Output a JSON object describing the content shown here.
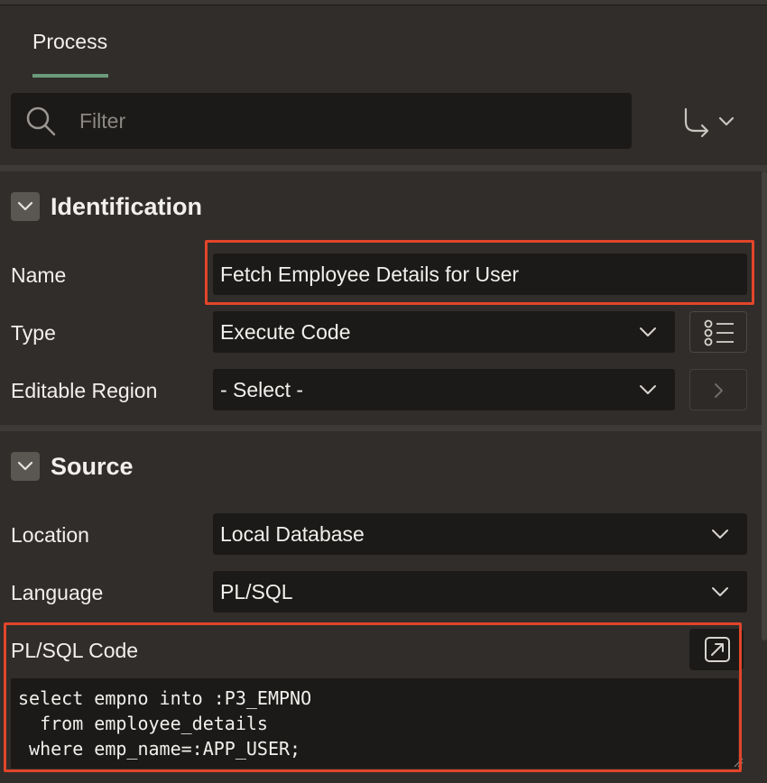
{
  "tabs": [
    {
      "label": "Process"
    }
  ],
  "filter": {
    "placeholder": "Filter"
  },
  "sections": {
    "identification": {
      "title": "Identification",
      "name": {
        "label": "Name",
        "value": "Fetch Employee Details for User"
      },
      "type": {
        "label": "Type",
        "value": "Execute Code"
      },
      "editable_region": {
        "label": "Editable Region",
        "value": "- Select -"
      }
    },
    "source": {
      "title": "Source",
      "location": {
        "label": "Location",
        "value": "Local Database"
      },
      "language": {
        "label": "Language",
        "value": "PL/SQL"
      },
      "code": {
        "label": "PL/SQL Code",
        "value": "select empno into :P3_EMPNO\n  from employee_details\n where emp_name=:APP_USER;"
      }
    }
  },
  "colors": {
    "background": "#312d2a",
    "field": "#1c1a18",
    "highlight": "#e2452a",
    "tab_underline": "#6b9b7b"
  },
  "icons": [
    "search-icon",
    "goto-arrow-icon",
    "chevron-down-icon",
    "list-icon",
    "chevron-right-icon",
    "expand-icon"
  ]
}
